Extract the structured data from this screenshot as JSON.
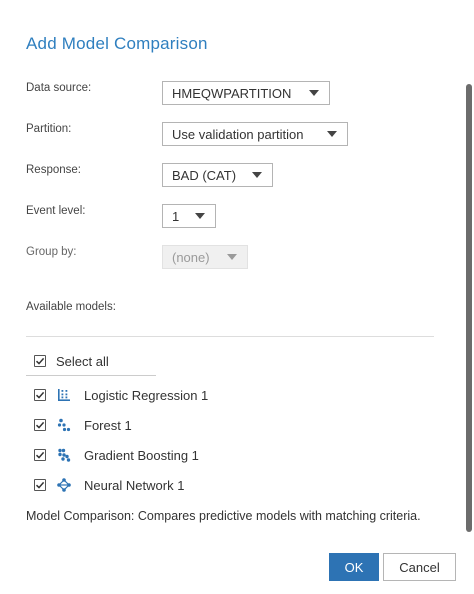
{
  "dialog": {
    "title": "Add Model Comparison",
    "fields": {
      "data_source": {
        "label": "Data source:",
        "value": "HMEQWPARTITION"
      },
      "partition": {
        "label": "Partition:",
        "value": "Use validation partition"
      },
      "response": {
        "label": "Response:",
        "value": "BAD (CAT)"
      },
      "event_level": {
        "label": "Event level:",
        "value": "1"
      },
      "group_by": {
        "label": "Group by:",
        "value": "(none)",
        "disabled": true
      }
    },
    "available_models": {
      "label": "Available models:",
      "select_all": {
        "label": "Select all",
        "checked": true
      },
      "items": [
        {
          "label": "Logistic Regression 1",
          "icon": "logistic-regression-icon",
          "checked": true
        },
        {
          "label": "Forest 1",
          "icon": "forest-icon",
          "checked": true
        },
        {
          "label": "Gradient Boosting 1",
          "icon": "gradient-boosting-icon",
          "checked": true
        },
        {
          "label": "Neural Network 1",
          "icon": "neural-network-icon",
          "checked": true
        }
      ]
    },
    "description": "Model Comparison: Compares predictive models with matching criteria.",
    "buttons": {
      "ok": "OK",
      "cancel": "Cancel"
    },
    "colors": {
      "title": "#2f7fbf",
      "primary_button": "#2d73b4",
      "icon_blue": "#2d73b4"
    }
  }
}
